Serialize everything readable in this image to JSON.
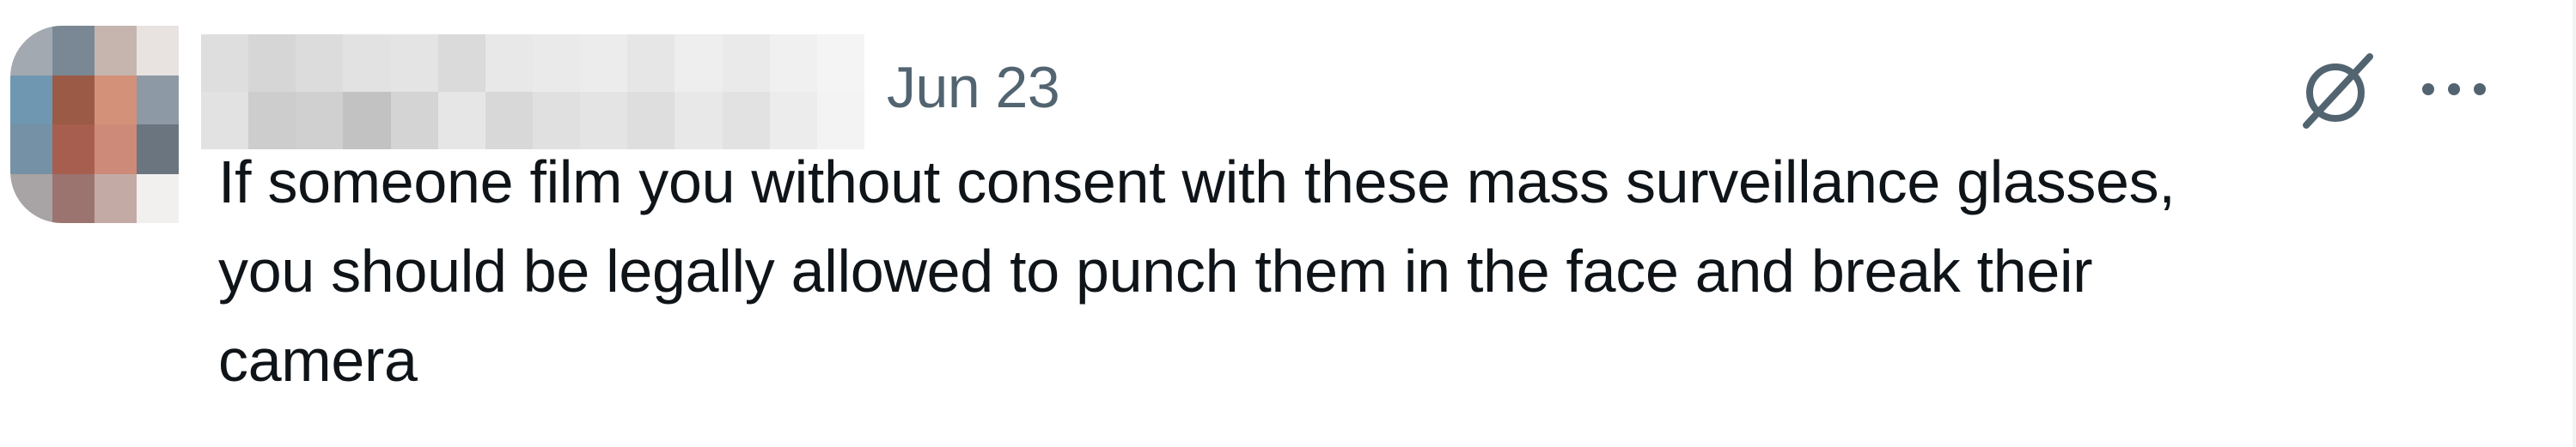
{
  "post": {
    "date": "Jun 23",
    "text": "If someone film you without consent with these mass surveillance glasses,\nyou should be legally allowed to punch them in the face and break their\ncamera",
    "icons": {
      "grok": "grok-icon",
      "more": "more-icon"
    }
  },
  "colors": {
    "text": "#0f1419",
    "secondary": "#536471",
    "background": "#ffffff"
  }
}
